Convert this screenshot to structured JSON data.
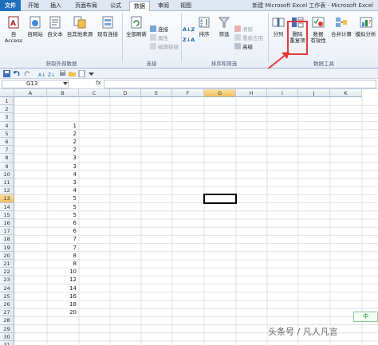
{
  "window_title": "新建 Microsoft Excel 工作表 - Microsoft Excel",
  "tabs": [
    "文件",
    "开始",
    "插入",
    "页面布局",
    "公式",
    "数据",
    "审阅",
    "视图"
  ],
  "active_tab": "数据",
  "ribbon": {
    "get_external": {
      "label": "获取外部数据",
      "buttons": [
        "自 Access",
        "自网站",
        "自文本",
        "自其他来源",
        "现有连接"
      ]
    },
    "connections": {
      "label": "连接",
      "refresh_all": "全部刷新",
      "items": [
        "连接",
        "属性",
        "编辑链接"
      ]
    },
    "sort_filter": {
      "label": "排序和筛选",
      "sort": "排序",
      "filter": "筛选",
      "items": [
        "清除",
        "重新应用",
        "高级"
      ]
    },
    "data_tools": {
      "label": "数据工具",
      "text_to_columns": "分列",
      "remove_dup_line1": "删除",
      "remove_dup_line2": "重复项",
      "validation_line1": "数据",
      "validation_line2": "有效性",
      "consolidate": "合并计算",
      "what_if": "模拟分析"
    }
  },
  "name_box": "G13",
  "fx_label": "fx",
  "columns": [
    "A",
    "B",
    "C",
    "D",
    "E",
    "F",
    "G",
    "H",
    "I",
    "J",
    "K"
  ],
  "selected_column": "G",
  "rows": [
    "1",
    "2",
    "3",
    "4",
    "5",
    "6",
    "7",
    "8",
    "9",
    "10",
    "11",
    "12",
    "13",
    "14",
    "15",
    "16",
    "17",
    "18",
    "19",
    "20",
    "21",
    "22",
    "23",
    "24",
    "25",
    "26",
    "27",
    "28",
    "29",
    "30",
    "31"
  ],
  "selected_row": "13",
  "column_b_values": {
    "4": "1",
    "5": "2",
    "6": "2",
    "7": "2",
    "8": "3",
    "9": "3",
    "10": "4",
    "11": "3",
    "12": "4",
    "13": "5",
    "14": "5",
    "15": "5",
    "16": "6",
    "17": "6",
    "18": "7",
    "19": "7",
    "20": "8",
    "21": "8",
    "22": "10",
    "23": "12",
    "24": "14",
    "25": "16",
    "26": "18",
    "27": "20"
  },
  "ime_indicator": "中",
  "watermark": "头条号 / 凡人凡言"
}
